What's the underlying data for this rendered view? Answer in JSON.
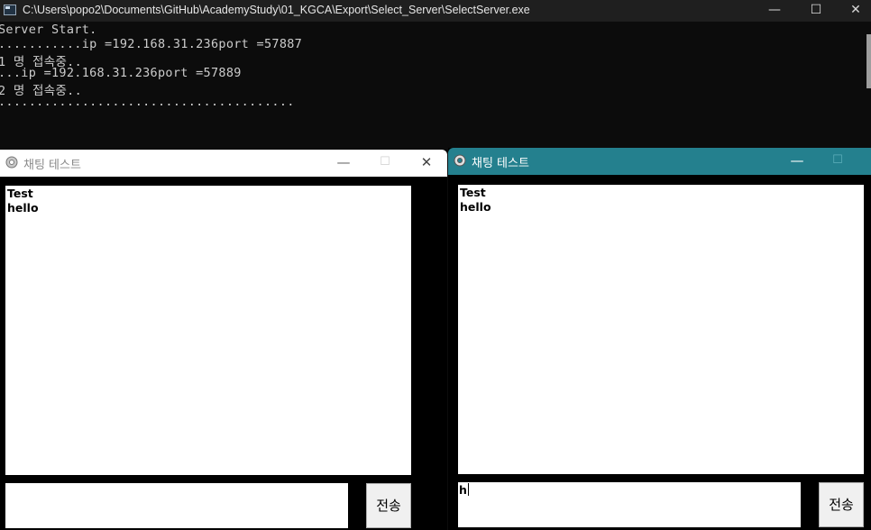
{
  "console": {
    "title": "C:\\Users\\popo2\\Documents\\GitHub\\AcademyStudy\\01_KGCA\\Export\\Select_Server\\SelectServer.exe",
    "lines": [
      "Server Start.",
      "...........ip =192.168.31.236port =57887",
      "1 명 접속중..",
      "...ip =192.168.31.236port =57889",
      "2 명 접속중..",
      "......................................."
    ],
    "minimize": "—",
    "maximize": "☐",
    "close": "✕"
  },
  "chat_left": {
    "title": "채팅 테스트",
    "messages": [
      "Test",
      "hello"
    ],
    "input_value": "",
    "send_label": "전송",
    "minimize": "—",
    "maximize": "☐",
    "close": "✕",
    "titlebar_color": "#ffffff"
  },
  "chat_right": {
    "title": "채팅 테스트",
    "messages": [
      "Test",
      "hello"
    ],
    "input_value": "h",
    "send_label": "전송",
    "minimize": "—",
    "maximize": "☐",
    "titlebar_color": "#24808e"
  }
}
